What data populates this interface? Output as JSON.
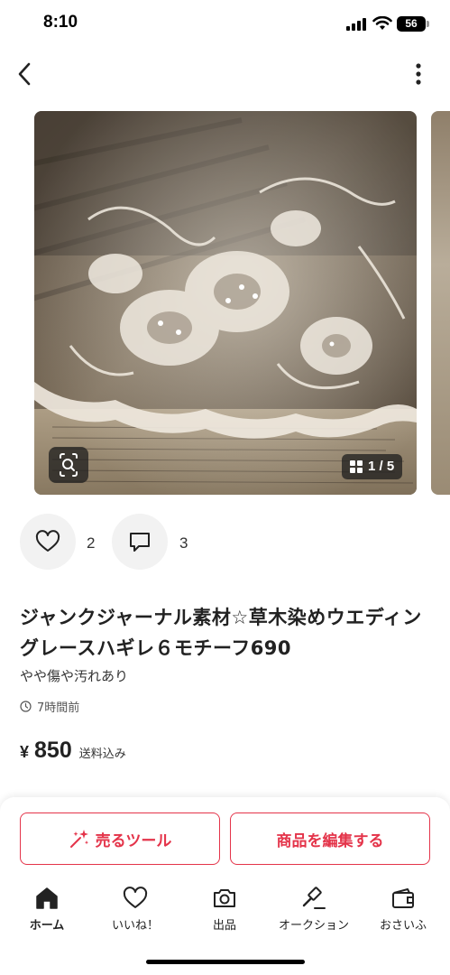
{
  "status_bar": {
    "time": "8:10",
    "battery": "56"
  },
  "gallery": {
    "counter": "1 / 5"
  },
  "actions": {
    "like_count": "2",
    "comment_count": "3"
  },
  "item": {
    "title": "ジャンクジャーナル素材☆草木染めウエディングレースハギレ６モチーフ690",
    "condition": "やや傷や汚れあり",
    "posted": "7時間前",
    "currency": "¥",
    "price": "850",
    "shipping": "送料込み"
  },
  "buttons": {
    "sell_tool": "売るツール",
    "edit": "商品を編集する"
  },
  "tabs": [
    {
      "label": "ホーム",
      "icon": "home-icon"
    },
    {
      "label": "いいね！",
      "icon": "heart-icon"
    },
    {
      "label": "出品",
      "icon": "camera-icon"
    },
    {
      "label": "オークション",
      "icon": "gavel-icon"
    },
    {
      "label": "おさいふ",
      "icon": "wallet-icon"
    }
  ],
  "colors": {
    "accent": "#e4344a",
    "text": "#222222"
  }
}
